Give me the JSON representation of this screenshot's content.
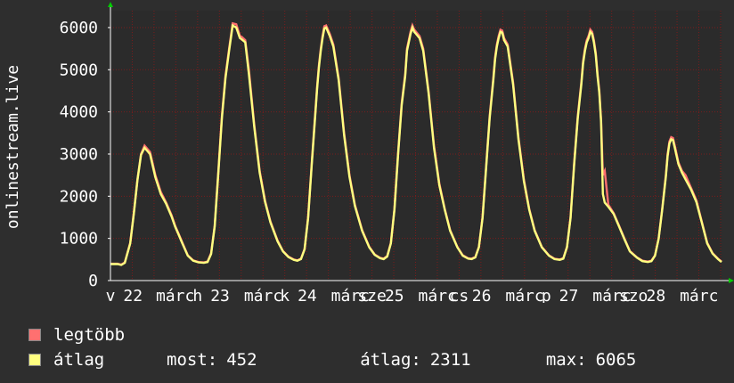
{
  "colors": {
    "background": "#2e2e2e",
    "plot_background": "#2b2b2b",
    "grid": "#7a1c1c",
    "axis": "#ffffff",
    "max_series": "#ff7070",
    "avg_series": "#ffff80"
  },
  "chart_data": {
    "type": "line",
    "ylabel": "onlinestream.live",
    "ylim": [
      0,
      6400
    ],
    "yticks": [
      0,
      1000,
      2000,
      3000,
      4000,
      5000,
      6000
    ],
    "xlim": [
      0,
      680
    ],
    "x_ticks": [
      {
        "x": 0,
        "label": "v"
      },
      {
        "x": 25,
        "label": "22"
      },
      {
        "x": 72,
        "label": "márc"
      },
      {
        "x": 97,
        "label": "h"
      },
      {
        "x": 122,
        "label": "23"
      },
      {
        "x": 170,
        "label": "márc"
      },
      {
        "x": 194,
        "label": "k"
      },
      {
        "x": 219,
        "label": "24"
      },
      {
        "x": 267,
        "label": "márc"
      },
      {
        "x": 291,
        "label": "sze"
      },
      {
        "x": 316,
        "label": "25"
      },
      {
        "x": 364,
        "label": "márc"
      },
      {
        "x": 388,
        "label": "cs"
      },
      {
        "x": 413,
        "label": "26"
      },
      {
        "x": 461,
        "label": "márc"
      },
      {
        "x": 485,
        "label": "p"
      },
      {
        "x": 510,
        "label": "27"
      },
      {
        "x": 558,
        "label": "márc"
      },
      {
        "x": 582,
        "label": "szo"
      },
      {
        "x": 607,
        "label": "28"
      },
      {
        "x": 655,
        "label": "márc"
      }
    ],
    "series": [
      {
        "name": "legtöbb",
        "x": [
          0,
          8,
          12,
          16,
          22,
          26,
          30,
          34,
          38,
          44,
          50,
          56,
          62,
          68,
          72,
          76,
          80,
          86,
          92,
          98,
          104,
          108,
          112,
          116,
          120,
          124,
          128,
          132,
          134,
          136,
          140,
          144,
          146,
          150,
          154,
          160,
          166,
          172,
          178,
          186,
          192,
          198,
          204,
          208,
          212,
          216,
          220,
          224,
          228,
          230,
          232,
          234,
          236,
          238,
          240,
          244,
          248,
          254,
          260,
          266,
          272,
          280,
          288,
          294,
          300,
          304,
          308,
          312,
          316,
          320,
          324,
          328,
          330,
          332,
          334,
          336,
          338,
          340,
          344,
          348,
          354,
          360,
          366,
          372,
          378,
          386,
          392,
          398,
          402,
          406,
          410,
          414,
          418,
          422,
          426,
          428,
          430,
          432,
          434,
          436,
          438,
          442,
          448,
          454,
          460,
          466,
          472,
          480,
          488,
          494,
          500,
          504,
          508,
          512,
          516,
          520,
          524,
          526,
          528,
          530,
          532,
          534,
          536,
          538,
          540,
          542,
          544,
          546,
          548,
          550,
          554,
          560,
          566,
          572,
          578,
          586,
          592,
          598,
          602,
          606,
          610,
          614,
          618,
          620,
          622,
          624,
          626,
          628,
          632,
          636,
          640,
          646,
          652,
          658,
          664,
          670,
          676,
          680
        ],
        "values": [
          400,
          400,
          380,
          430,
          900,
          1600,
          2400,
          3000,
          3200,
          3050,
          2500,
          2100,
          1850,
          1550,
          1300,
          1100,
          900,
          600,
          480,
          440,
          430,
          450,
          650,
          1300,
          2600,
          3900,
          4850,
          5500,
          5800,
          6100,
          6080,
          5800,
          5780,
          5700,
          5000,
          3700,
          2600,
          1900,
          1400,
          950,
          700,
          570,
          500,
          480,
          520,
          750,
          1500,
          2800,
          4000,
          4600,
          5100,
          5500,
          5800,
          6030,
          6050,
          5850,
          5600,
          4800,
          3500,
          2500,
          1800,
          1200,
          800,
          620,
          540,
          520,
          580,
          900,
          1700,
          3000,
          4200,
          4900,
          5500,
          5700,
          5900,
          6050,
          5950,
          5900,
          5800,
          5500,
          4500,
          3200,
          2300,
          1700,
          1200,
          800,
          600,
          530,
          520,
          560,
          800,
          1500,
          2700,
          3900,
          4800,
          5300,
          5600,
          5800,
          5950,
          5930,
          5750,
          5600,
          4700,
          3400,
          2400,
          1700,
          1200,
          800,
          600,
          520,
          500,
          530,
          800,
          1500,
          2800,
          3900,
          4700,
          5200,
          5500,
          5700,
          5800,
          5950,
          5900,
          5700,
          5400,
          4900,
          4500,
          3800,
          2500,
          2600,
          1800,
          1600,
          1300,
          1000,
          700,
          550,
          470,
          450,
          470,
          600,
          1000,
          1700,
          2500,
          3000,
          3300,
          3400,
          3380,
          3200,
          2800,
          2600,
          2500,
          2200,
          1900,
          1400,
          900,
          650,
          520,
          450
        ]
      },
      {
        "name": "átlag",
        "x": [
          0,
          8,
          12,
          16,
          22,
          26,
          30,
          34,
          38,
          44,
          50,
          56,
          62,
          68,
          72,
          76,
          80,
          86,
          92,
          98,
          104,
          108,
          112,
          116,
          120,
          124,
          128,
          132,
          134,
          136,
          140,
          144,
          146,
          150,
          154,
          160,
          166,
          172,
          178,
          186,
          192,
          198,
          204,
          208,
          212,
          216,
          220,
          224,
          228,
          230,
          232,
          234,
          236,
          238,
          240,
          244,
          248,
          254,
          260,
          266,
          272,
          280,
          288,
          294,
          300,
          304,
          308,
          312,
          316,
          320,
          324,
          328,
          330,
          332,
          334,
          336,
          338,
          340,
          344,
          348,
          354,
          360,
          366,
          372,
          378,
          386,
          392,
          398,
          402,
          406,
          410,
          414,
          418,
          422,
          426,
          428,
          430,
          432,
          434,
          436,
          438,
          442,
          448,
          454,
          460,
          466,
          472,
          480,
          488,
          494,
          500,
          504,
          508,
          512,
          516,
          520,
          524,
          526,
          528,
          530,
          532,
          534,
          536,
          538,
          540,
          542,
          544,
          546,
          548,
          550,
          554,
          560,
          566,
          572,
          578,
          586,
          592,
          598,
          602,
          606,
          610,
          614,
          618,
          620,
          622,
          624,
          626,
          628,
          632,
          636,
          640,
          646,
          652,
          658,
          664,
          670,
          676,
          680
        ],
        "values": [
          390,
          390,
          370,
          420,
          880,
          1580,
          2380,
          2980,
          3150,
          3000,
          2450,
          2050,
          1820,
          1520,
          1280,
          1080,
          880,
          590,
          470,
          430,
          420,
          440,
          630,
          1280,
          2550,
          3850,
          4800,
          5450,
          5750,
          6050,
          6000,
          5750,
          5720,
          5650,
          4900,
          3650,
          2560,
          1870,
          1380,
          930,
          690,
          560,
          490,
          470,
          510,
          740,
          1480,
          2760,
          3950,
          4550,
          5050,
          5450,
          5750,
          5980,
          6000,
          5800,
          5550,
          4750,
          3450,
          2460,
          1770,
          1180,
          790,
          610,
          530,
          510,
          570,
          880,
          1680,
          2960,
          4150,
          4850,
          5450,
          5650,
          5850,
          6000,
          5900,
          5850,
          5750,
          5450,
          4450,
          3150,
          2260,
          1680,
          1180,
          790,
          590,
          520,
          510,
          550,
          790,
          1480,
          2660,
          3850,
          4750,
          5250,
          5550,
          5750,
          5900,
          5880,
          5700,
          5550,
          4650,
          3350,
          2360,
          1680,
          1180,
          790,
          590,
          510,
          490,
          520,
          790,
          1480,
          2760,
          3850,
          4650,
          5150,
          5450,
          5650,
          5750,
          5900,
          5850,
          5650,
          5350,
          4850,
          4450,
          3750,
          2050,
          1850,
          1750,
          1580,
          1280,
          980,
          690,
          540,
          460,
          440,
          460,
          590,
          990,
          1680,
          2460,
          2960,
          3250,
          3350,
          3330,
          3150,
          2760,
          2560,
          2400,
          2160,
          1860,
          1380,
          880,
          640,
          510,
          440
        ]
      }
    ],
    "legend_position": "bottom-left",
    "grid": true
  },
  "legend": {
    "max_label": "legtöbb",
    "avg_label": "átlag",
    "stats": {
      "now_label": "most:",
      "now_value": "452",
      "avg_label": "átlag:",
      "avg_value": "2311",
      "max_label": "max:",
      "max_value": "6065"
    }
  }
}
